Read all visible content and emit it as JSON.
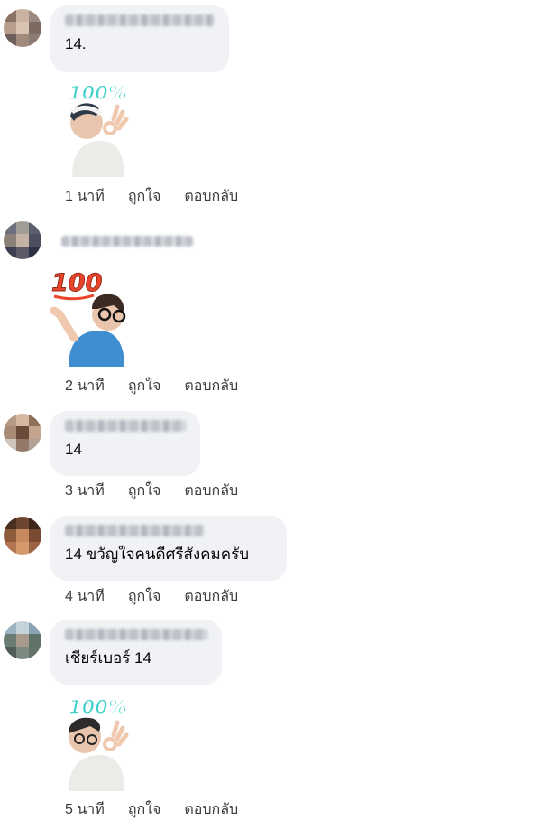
{
  "comments": [
    {
      "text": "14.",
      "time": "1 นาที",
      "like": "ถูกใจ",
      "reply": "ตอบกลับ",
      "sticker": "100%"
    },
    {
      "text": "",
      "time": "2 นาที",
      "like": "ถูกใจ",
      "reply": "ตอบกลับ",
      "sticker": "100"
    },
    {
      "text": "14",
      "time": "3 นาที",
      "like": "ถูกใจ",
      "reply": "ตอบกลับ"
    },
    {
      "text": "14 ขวัญใจคนดีศรีสังคมครับ",
      "time": "4 นาที",
      "like": "ถูกใจ",
      "reply": "ตอบกลับ"
    },
    {
      "text": "เชียร์เบอร์ 14",
      "time": "5 นาที",
      "like": "ถูกใจ",
      "reply": "ตอบกลับ",
      "sticker": "100%"
    }
  ],
  "icons": [
    "avatar",
    "sticker-100-percent-ok-hand",
    "sticker-100-pointing"
  ],
  "colors": {
    "bubble": "#f0f2f5",
    "meta_text": "#3a3b3c",
    "sticker_teal": "#3fd0c9",
    "sticker_red": "#e8452c"
  }
}
